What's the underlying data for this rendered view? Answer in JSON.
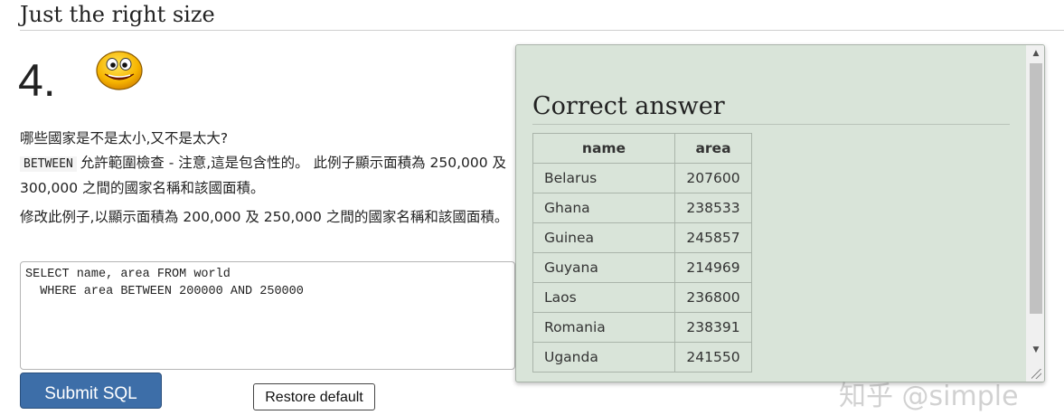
{
  "page": {
    "title": "Just the right size",
    "question_number": "4.",
    "paragraph1_after_code": "允許範圍檢查 - 注意,這是包含性的。 此例子顯示面積為 250,000 及 300,000 之間的國家名稱和該國面積。",
    "paragraph1_lead": "哪些國家是不是太小,又不是太大?",
    "keyword": "BETWEEN",
    "paragraph2": "修改此例子,以顯示面積為 200,000 及 250,000 之間的國家名稱和該國面積。"
  },
  "editor": {
    "value": "SELECT name, area FROM world\n  WHERE area BETWEEN 200000 AND 250000"
  },
  "buttons": {
    "submit_label": "Submit SQL",
    "restore_label": "Restore default"
  },
  "answer": {
    "title": "Correct answer",
    "columns": [
      "name",
      "area"
    ],
    "rows": [
      [
        "Belarus",
        "207600"
      ],
      [
        "Ghana",
        "238533"
      ],
      [
        "Guinea",
        "245857"
      ],
      [
        "Guyana",
        "214969"
      ],
      [
        "Laos",
        "236800"
      ],
      [
        "Romania",
        "238391"
      ],
      [
        "Uganda",
        "241550"
      ]
    ]
  },
  "watermark": "知乎 @simple",
  "icons": {
    "smiley": "smiley-face-icon",
    "scroll_up": "scroll-up-arrow-icon",
    "scroll_down": "scroll-down-arrow-icon"
  },
  "colors": {
    "panel_bg": "#d9e4d9",
    "submit_bg": "#3d6ea8"
  }
}
